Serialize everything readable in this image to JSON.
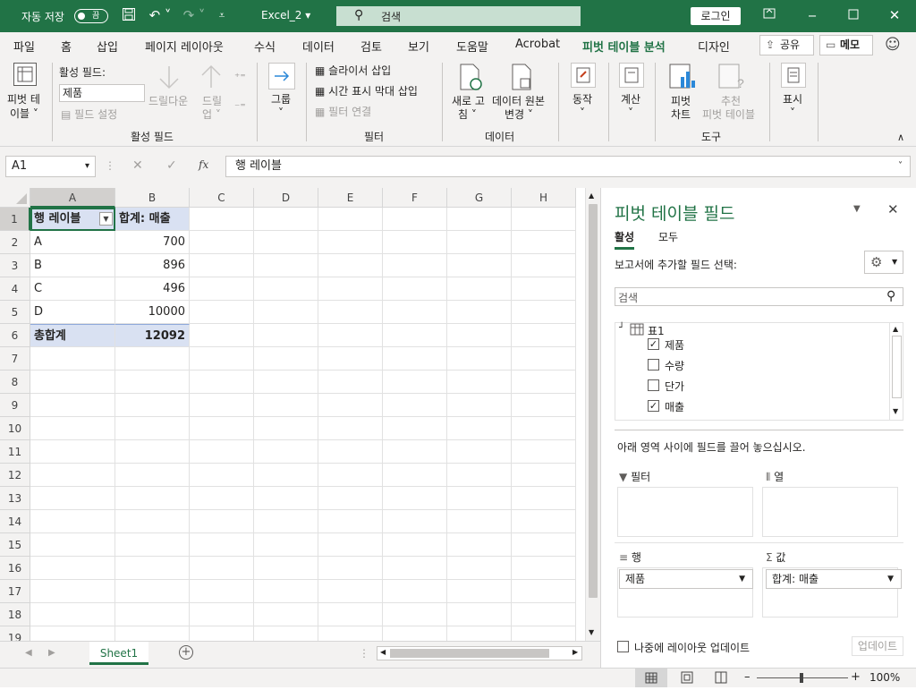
{
  "titlebar": {
    "autosave_label": "자동 저장",
    "autosave_state": "끔",
    "filename": "Excel_2",
    "search_placeholder": "검색",
    "login_label": "로그인",
    "bg_color": "#217346"
  },
  "tabs": [
    "파일",
    "홈",
    "삽입",
    "페이지 레이아웃",
    "수식",
    "데이터",
    "검토",
    "보기",
    "도움말",
    "Acrobat",
    "피벗 테이블 분석",
    "디자인"
  ],
  "active_tab": "피벗 테이블 분석",
  "share_label": "공유",
  "memo_label": "메모",
  "ribbon": {
    "pivot_table_label1": "피벗 테",
    "pivot_table_label2": "이블",
    "active_field_label": "활성 필드:",
    "active_field_value": "제품",
    "field_settings": "필드 설정",
    "drill_down": "드릴다운",
    "drill_up1": "드릴",
    "drill_up2": "업",
    "group_active_field": "활성 필드",
    "group_label": "그룹",
    "insert_slicer": "슬라이서 삽입",
    "insert_timeline": "시간 표시 막대 삽입",
    "filter_connections": "필터 연결",
    "group_filter": "필터",
    "refresh1": "새로 고",
    "refresh2": "침",
    "change_source1": "데이터 원본",
    "change_source2": "변경",
    "group_data": "데이터",
    "actions": "동작",
    "calculations": "계산",
    "pivot_chart1": "피벗",
    "pivot_chart2": "차트",
    "recommended1": "추천",
    "recommended2": "피벗 테이블",
    "group_tools": "도구",
    "show": "표시"
  },
  "formula": {
    "name_box": "A1",
    "content": "행 레이블"
  },
  "grid": {
    "columns": [
      "A",
      "B",
      "C",
      "D",
      "E",
      "F",
      "G",
      "H"
    ],
    "rows": [
      "1",
      "2",
      "3",
      "4",
      "5",
      "6",
      "7",
      "8",
      "9",
      "10",
      "11",
      "12",
      "13",
      "14",
      "15",
      "16",
      "17",
      "18",
      "19"
    ],
    "header": [
      "행 레이블",
      "합계: 매출"
    ],
    "data": [
      [
        "A",
        "700"
      ],
      [
        "B",
        "896"
      ],
      [
        "C",
        "496"
      ],
      [
        "D",
        "10000"
      ]
    ],
    "total": [
      "총합계",
      "12092"
    ]
  },
  "sheet_tab": "Sheet1",
  "zoom": "100%",
  "pane": {
    "title": "피벗 테이블 필드",
    "tab_active": "활성",
    "tab_all": "모두",
    "choose_label": "보고서에 추가할 필드 선택:",
    "search_placeholder": "검색",
    "table_name": "표1",
    "fields": [
      {
        "name": "제품",
        "checked": true
      },
      {
        "name": "수량",
        "checked": false
      },
      {
        "name": "단가",
        "checked": false
      },
      {
        "name": "매출",
        "checked": true
      }
    ],
    "drag_hint": "아래 영역 사이에 필드를 끌어 놓으십시오.",
    "area_filter": "필터",
    "area_columns": "열",
    "area_rows": "행",
    "area_values": "값",
    "rows_item": "제품",
    "values_item": "합계: 매출",
    "defer_label": "나중에 레이아웃 업데이트",
    "update_btn": "업데이트"
  }
}
